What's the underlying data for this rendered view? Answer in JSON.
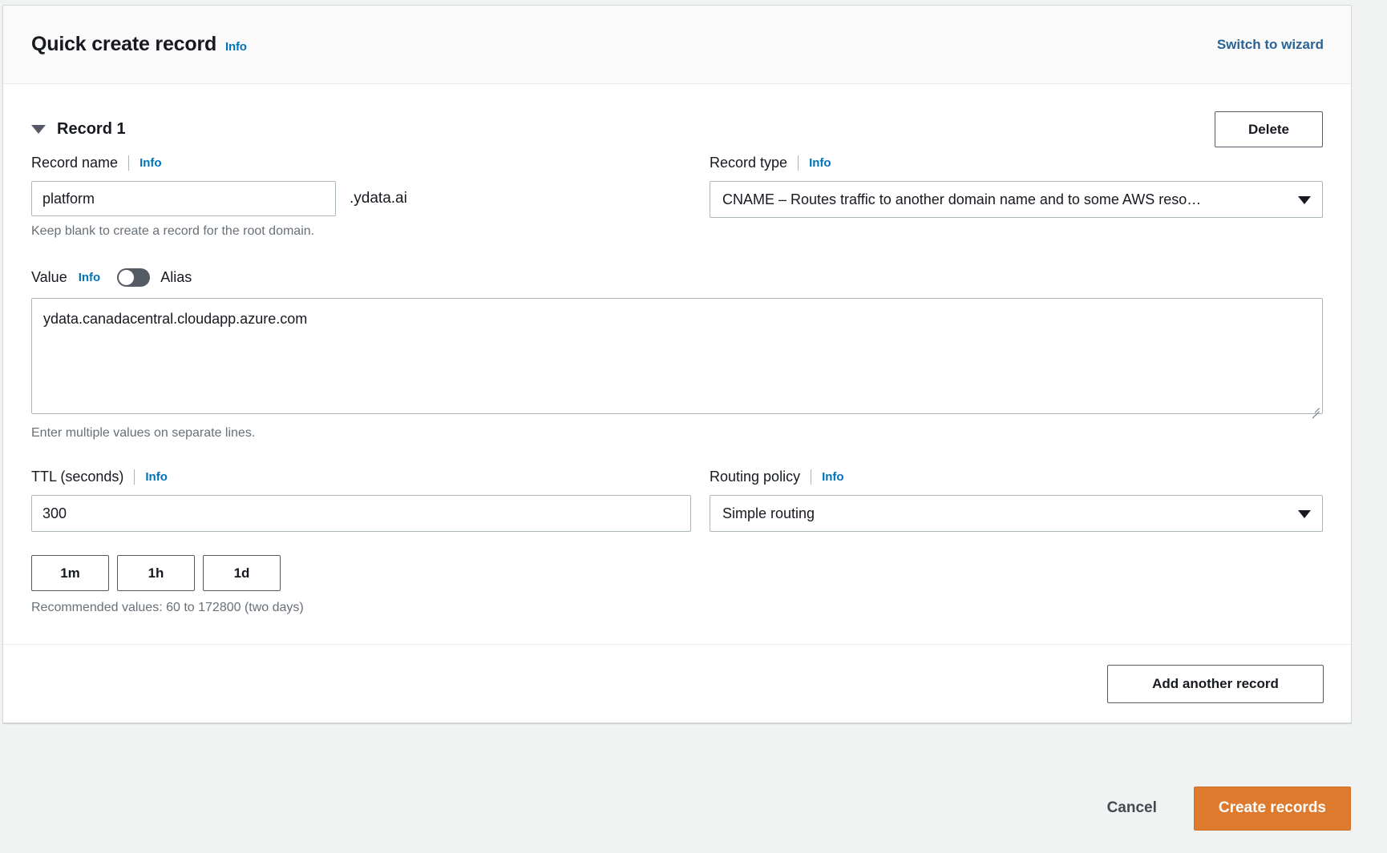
{
  "header": {
    "title": "Quick create record",
    "info_label": "Info",
    "switch_label": "Switch to wizard"
  },
  "record": {
    "section_label": "Record 1",
    "delete_label": "Delete",
    "caret_icon": "chevron-down-icon",
    "name": {
      "label": "Record name",
      "info_label": "Info",
      "value": "platform",
      "placeholder": "",
      "suffix": ".ydata.ai",
      "hint": "Keep blank to create a record for the root domain."
    },
    "type": {
      "label": "Record type",
      "info_label": "Info",
      "selected": "CNAME – Routes traffic to another domain name and to some AWS reso…",
      "arrow_icon": "chevron-down-icon"
    },
    "value": {
      "label": "Value",
      "info_label": "Info",
      "alias_label": "Alias",
      "alias_enabled": false,
      "text": "ydata.canadacentral.cloudapp.azure.com",
      "placeholder": "",
      "hint": "Enter multiple values on separate lines.",
      "resize_icon": "resize-grip-icon"
    },
    "ttl": {
      "label": "TTL (seconds)",
      "info_label": "Info",
      "value": "300",
      "placeholder": "",
      "quick_values": [
        "1m",
        "1h",
        "1d"
      ],
      "hint": "Recommended values: 60 to 172800 (two days)"
    },
    "routing": {
      "label": "Routing policy",
      "info_label": "Info",
      "selected": "Simple routing",
      "arrow_icon": "chevron-down-icon"
    }
  },
  "card_footer": {
    "add_label": "Add another record"
  },
  "page_footer": {
    "cancel_label": "Cancel",
    "create_label": "Create records"
  },
  "colors": {
    "page_background": "#f1f3f3",
    "card_background": "#ffffff",
    "header_background": "#fafafa",
    "link": "#0073bb",
    "switch_link": "#2a6496",
    "primary_button": "#dd7a2e",
    "border": "#aab7b8",
    "toggle_track": "#545b64",
    "hint_text": "#687078"
  }
}
